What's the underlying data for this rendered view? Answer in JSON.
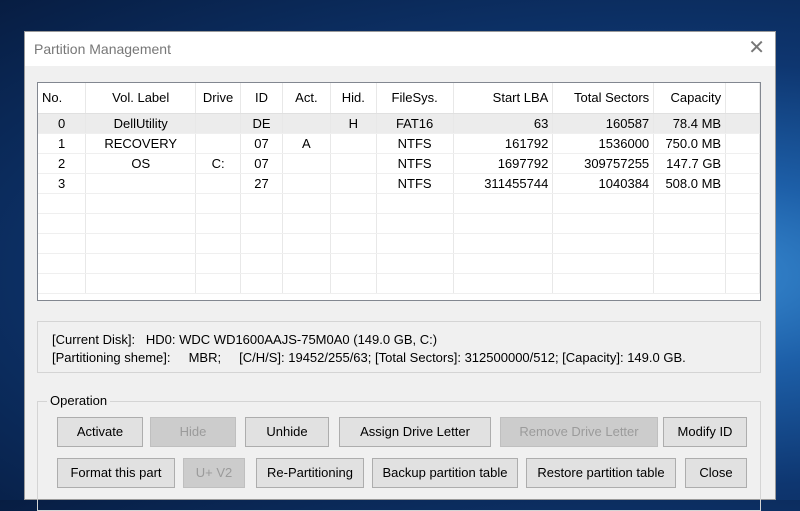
{
  "window": {
    "title": "Partition Management"
  },
  "table": {
    "headers": [
      "No.",
      "Vol. Label",
      "Drive",
      "ID",
      "Act.",
      "Hid.",
      "FileSys.",
      "Start LBA",
      "Total Sectors",
      "Capacity"
    ],
    "rows": [
      [
        "0",
        "DellUtility",
        "",
        "DE",
        "",
        "H",
        "FAT16",
        "63",
        "160587",
        "78.4 MB"
      ],
      [
        "1",
        "RECOVERY",
        "",
        "07",
        "A",
        "",
        "NTFS",
        "161792",
        "1536000",
        "750.0 MB"
      ],
      [
        "2",
        "OS",
        "C:",
        "07",
        "",
        "",
        "NTFS",
        "1697792",
        "309757255",
        "147.7 GB"
      ],
      [
        "3",
        "",
        "",
        "27",
        "",
        "",
        "NTFS",
        "311455744",
        "1040384",
        "508.0 MB"
      ]
    ]
  },
  "info": {
    "current_disk": "[Current Disk]:   HD0: WDC WD1600AAJS-75M0A0 (149.0 GB, C:)",
    "partitioning": "[Partitioning sheme]:     MBR;     [C/H/S]: 19452/255/63; [Total Sectors]: 312500000/512; [Capacity]: 149.0 GB."
  },
  "operation": {
    "legend": "Operation",
    "buttons": {
      "activate": "Activate",
      "hide": "Hide",
      "unhide": "Unhide",
      "assign": "Assign Drive Letter",
      "remove": "Remove Drive Letter",
      "modify": "Modify ID",
      "format": "Format this part",
      "uv2": "U+ V2",
      "repart": "Re-Partitioning",
      "backup": "Backup partition table",
      "restore": "Restore partition table",
      "close": "Close"
    }
  },
  "colors": {
    "accent_selected_row": "#ececec",
    "disabled_text": "#9b9b9b"
  }
}
